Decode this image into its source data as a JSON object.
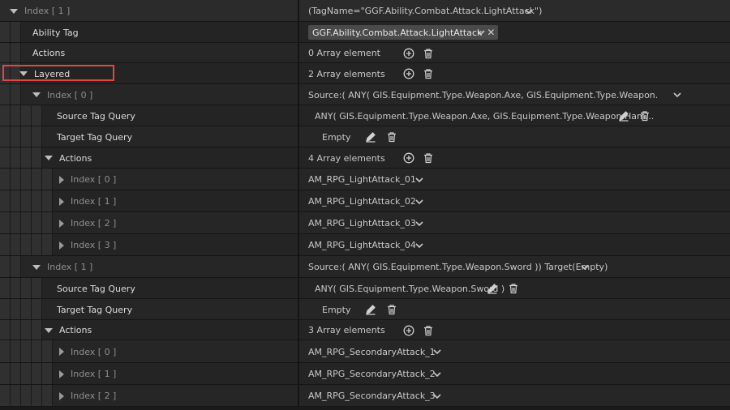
{
  "rows": [
    {
      "label": "Index [ 1 ]",
      "value": "(TagName=\"GGF.Ability.Combat.Attack.LightAttack\")"
    },
    {
      "label": "Ability Tag",
      "tag_chip": "GGF.Ability.Combat.Attack.LightAttack"
    },
    {
      "label": "Actions",
      "value": "0 Array element"
    },
    {
      "label": "Layered",
      "value": "2 Array elements"
    },
    {
      "label": "Index [ 0 ]",
      "value": "Source:( ANY( GIS.Equipment.Type.Weapon.Axe, GIS.Equipment.Type.Weapon.Hammer )) Ta"
    },
    {
      "label": "Source Tag Query",
      "value": "ANY( GIS.Equipment.Type.Weapon.Axe, GIS.Equipment.Type.Weapon.Ham..."
    },
    {
      "label": "Target Tag Query",
      "value": "Empty"
    },
    {
      "label": "Actions",
      "value": "4 Array elements"
    },
    {
      "label": "Index [ 0 ]",
      "value": "AM_RPG_LightAttack_01"
    },
    {
      "label": "Index [ 1 ]",
      "value": "AM_RPG_LightAttack_02"
    },
    {
      "label": "Index [ 2 ]",
      "value": "AM_RPG_LightAttack_03"
    },
    {
      "label": "Index [ 3 ]",
      "value": "AM_RPG_LightAttack_04"
    },
    {
      "label": "Index [ 1 ]",
      "value": "Source:( ANY( GIS.Equipment.Type.Weapon.Sword )) Target(Empty)"
    },
    {
      "label": "Source Tag Query",
      "value": "ANY( GIS.Equipment.Type.Weapon.Sword )"
    },
    {
      "label": "Target Tag Query",
      "value": "Empty"
    },
    {
      "label": "Actions",
      "value": "3 Array elements"
    },
    {
      "label": "Index [ 0 ]",
      "value": "AM_RPG_SecondaryAttack_1"
    },
    {
      "label": "Index [ 1 ]",
      "value": "AM_RPG_SecondaryAttack_2"
    },
    {
      "label": "Index [ 2 ]",
      "value": "AM_RPG_SecondaryAttack_3"
    }
  ],
  "icons": {
    "add": "plus-circle-icon",
    "delete": "trash-icon",
    "edit": "pencil-icon",
    "expand": "chevron-down-icon",
    "clear": "close-icon"
  },
  "colors": {
    "highlight_box": "#e04646"
  }
}
